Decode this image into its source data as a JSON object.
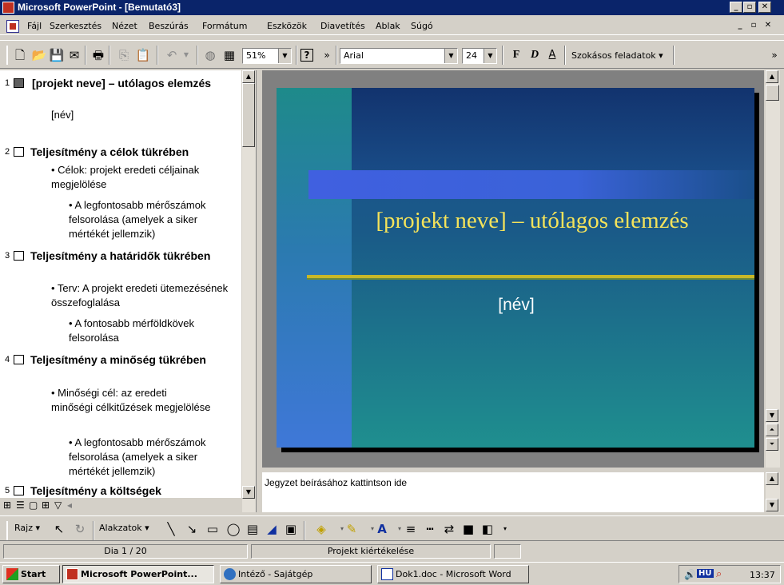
{
  "window": {
    "title": "Microsoft PowerPoint - [Bemutató3]"
  },
  "menu": {
    "items": [
      "Fájl",
      "Szerkesztés",
      "Nézet",
      "Beszúrás",
      "Formátum",
      "Eszközök",
      "Diavetítés",
      "Ablak",
      "Súgó"
    ]
  },
  "toolbar": {
    "zoom": "51%",
    "font": "Arial",
    "font_size": "24",
    "bold": "F",
    "italic": "D",
    "underline": "A",
    "tasks": "Szokásos feladatok ▾",
    "more": "»"
  },
  "outline": {
    "slides": [
      {
        "num": "1",
        "title": "[projekt neve] – utólagos elemzés",
        "bullets": [
          {
            "level": 0,
            "text": "[név]"
          }
        ]
      },
      {
        "num": "2",
        "title": "Teljesítmény a célok tükrében",
        "bullets": [
          {
            "level": 1,
            "text": "• Célok: projekt eredeti céljainak megjelölése"
          },
          {
            "level": 2,
            "text": "• A legfontosabb mérőszámok felsorolása (amelyek a siker mértékét jellemzik)"
          }
        ]
      },
      {
        "num": "3",
        "title": "Teljesítmény a határidők tükrében",
        "bullets": [
          {
            "level": 1,
            "text": "• Terv: A projekt eredeti ütemezésének összefoglalása"
          },
          {
            "level": 2,
            "text": "• A fontosabb mérföldkövek felsorolása"
          }
        ]
      },
      {
        "num": "4",
        "title": "Teljesítmény a minőség tükrében",
        "bullets": [
          {
            "level": 1,
            "text": "• Minőségi cél: az eredeti minőségi célkitűzések megjelölése"
          },
          {
            "level": 2,
            "text": "• A legfontosabb mérőszámok felsorolása (amelyek a siker mértékét jellemzik)"
          }
        ]
      },
      {
        "num": "5",
        "title": "Teljesítmény a költségek",
        "bullets": []
      }
    ]
  },
  "slide": {
    "title": "[projekt neve] – utólagos elemzés",
    "subtitle": "[név]"
  },
  "notes": {
    "placeholder": "Jegyzet beírásához kattintson ide"
  },
  "drawing": {
    "draw": "Rajz ▾",
    "shapes": "Alakzatok ▾"
  },
  "status": {
    "slide": "Dia 1 / 20",
    "design": "Projekt kiértékelése"
  },
  "taskbar": {
    "start": "Start",
    "buttons": [
      "Microsoft PowerPoint...",
      "Intéző - Sajátgép",
      "Dok1.doc - Microsoft Word"
    ],
    "lang": "HU",
    "clock": "13:37"
  },
  "colors": {
    "titlebar": "#0a246a",
    "slide_title": "#f5e35a",
    "slide_rule": "#c8b828"
  }
}
